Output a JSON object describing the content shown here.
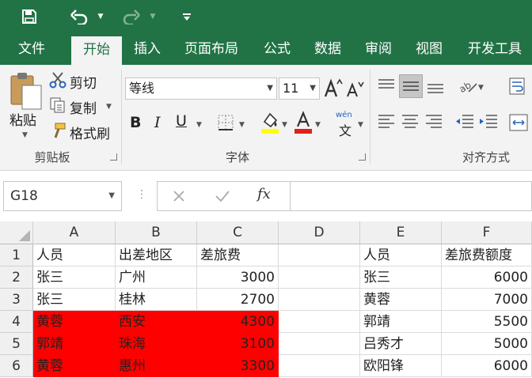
{
  "tabs": [
    "文件",
    "开始",
    "插入",
    "页面布局",
    "公式",
    "数据",
    "审阅",
    "视图",
    "开发工具"
  ],
  "active_tab": "开始",
  "clipboard": {
    "paste_label": "粘贴",
    "cut_label": "剪切",
    "copy_label": "复制",
    "format_painter_label": "格式刷",
    "group_label": "剪贴板"
  },
  "font": {
    "font_name": "等线",
    "font_size": "11",
    "wen_label": "wén",
    "wen_char": "文",
    "group_label": "字体"
  },
  "alignment": {
    "group_label": "对齐方式"
  },
  "formula_bar": {
    "name_box": "G18",
    "fx_label": "fx",
    "formula": ""
  },
  "columns": [
    "A",
    "B",
    "C",
    "D",
    "E",
    "F"
  ],
  "rows": [
    "1",
    "2",
    "3",
    "4",
    "5",
    "6"
  ],
  "cells": [
    [
      "人员",
      "出差地区",
      "差旅费",
      "",
      "人员",
      "差旅费额度"
    ],
    [
      "张三",
      "广州",
      "3000",
      "",
      "张三",
      "6000"
    ],
    [
      "张三",
      "桂林",
      "2700",
      "",
      "黄蓉",
      "7000"
    ],
    [
      "黄蓉",
      "西安",
      "4300",
      "",
      "郭靖",
      "5500"
    ],
    [
      "郭靖",
      "珠海",
      "3100",
      "",
      "吕秀才",
      "5000"
    ],
    [
      "黄蓉",
      "惠州",
      "3300",
      "",
      "欧阳锋",
      "6000"
    ]
  ],
  "colors": {
    "excel_green": "#217346",
    "highlight_red": "#ff0000",
    "font_color_red": "#e0201b",
    "fill_yellow": "#ffff00"
  }
}
